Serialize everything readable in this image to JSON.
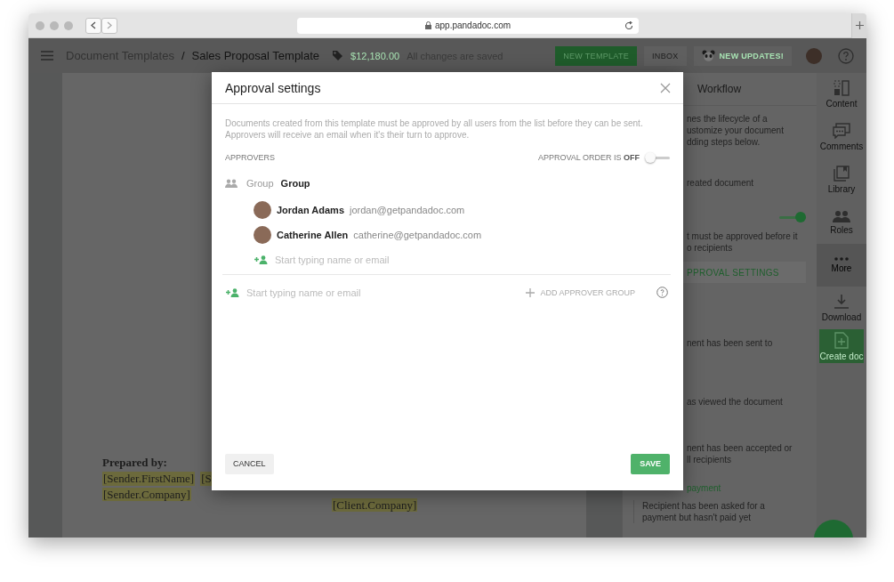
{
  "browser": {
    "url": "app.pandadoc.com"
  },
  "header": {
    "breadcrumb": [
      "Document Templates",
      "Sales Proposal Template"
    ],
    "separator": "/",
    "amount": "$12,180.00",
    "save_status": "All changes are saved",
    "buttons": [
      {
        "label": "NEW TEMPLATE",
        "kind": "primary"
      },
      {
        "label": "INBOX",
        "kind": "plain"
      },
      {
        "label": "NEW UPDATES!",
        "kind": "updates"
      }
    ]
  },
  "document": {
    "prepared_label": "Prepared by:",
    "sender_fields": [
      "[Sender.FirstName]",
      "[S"
    ],
    "sender_company": "[Sender.Company]",
    "client_company": "[Client.Company]"
  },
  "workflow": {
    "title": "Workflow",
    "blocks": [
      {
        "kind": "text",
        "lines": [
          "nes the lifecycle of a",
          "ustomize your document",
          "dding steps below."
        ]
      },
      {
        "kind": "text",
        "lines": [
          "reated document"
        ]
      },
      {
        "kind": "toggle",
        "on": true
      },
      {
        "kind": "text",
        "lines": [
          "t must be approved before it",
          "o recipients"
        ]
      },
      {
        "kind": "button",
        "label": "PPROVAL SETTINGS"
      },
      {
        "kind": "text",
        "lines": [
          "nent has been sent to"
        ]
      },
      {
        "kind": "text",
        "lines": [
          "as viewed the document"
        ]
      },
      {
        "kind": "text",
        "lines": [
          "nent has been accepted or",
          "ll recipients"
        ]
      },
      {
        "kind": "heading",
        "label": "payment"
      },
      {
        "kind": "full",
        "lines": [
          "Recipient has been asked for a",
          "payment but hasn't paid yet"
        ]
      }
    ]
  },
  "rail": [
    {
      "label": "Content",
      "kind": "content",
      "selected": false
    },
    {
      "label": "Comments",
      "kind": "comments",
      "selected": false
    },
    {
      "label": "Library",
      "kind": "library",
      "selected": false
    },
    {
      "label": "Roles",
      "kind": "roles",
      "selected": false
    },
    {
      "label": "More",
      "kind": "more",
      "selected": true
    },
    {
      "label": "Download",
      "kind": "download",
      "selected": false
    },
    {
      "label": "Create doc",
      "kind": "create",
      "selected": false
    }
  ],
  "modal": {
    "title": "Approval settings",
    "description": "Documents created from this template must be approved by all users from the list before they can be sent. Approvers will receive an email when it's their turn to approve.",
    "approvers_label": "APPROVERS",
    "approval_order": {
      "label": "APPROVAL ORDER IS",
      "value": "OFF",
      "on": false
    },
    "group": {
      "label": "Group",
      "name": "Group",
      "members": [
        {
          "name": "Jordan Adams",
          "email": "jordan@getpandadoc.com"
        },
        {
          "name": "Catherine Allen",
          "email": "catherine@getpandadoc.com"
        }
      ],
      "placeholder": "Start typing name or email"
    },
    "add_placeholder": "Start typing name or email",
    "add_group": "ADD APPROVER GROUP",
    "cancel": "CANCEL",
    "save": "SAVE"
  }
}
